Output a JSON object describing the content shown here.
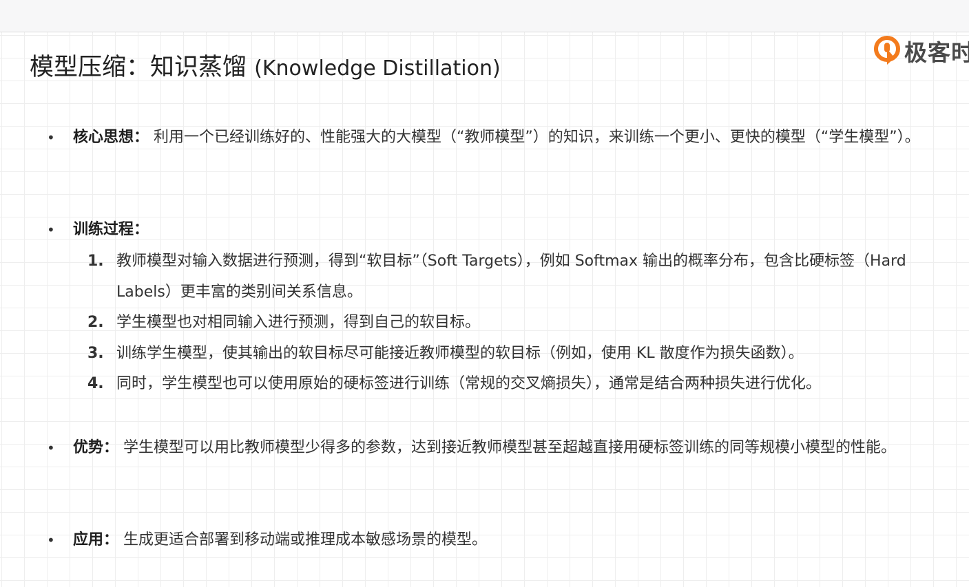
{
  "brand": {
    "name": "极客时间",
    "accent": "#f37b1d"
  },
  "slide": {
    "title_cn": "模型压缩：知识蒸馏",
    "title_en": "(Knowledge Distillation)"
  },
  "bullets": {
    "core_idea": {
      "label": "核心思想：",
      "text": "利用一个已经训练好的、性能强大的大模型（“教师模型”）的知识，来训练一个更小、更快的模型（“学生模型”）。"
    },
    "training": {
      "label": "训练过程：",
      "steps": [
        {
          "num": "1.",
          "text": "教师模型对输入数据进行预测，得到“软目标”（Soft Targets），例如 Softmax 输出的概率分布，包含比硬标签（Hard Labels）更丰富的类别间关系信息。"
        },
        {
          "num": "2.",
          "text": "学生模型也对相同输入进行预测，得到自己的软目标。"
        },
        {
          "num": "3.",
          "text": "训练学生模型，使其输出的软目标尽可能接近教师模型的软目标（例如，使用 KL 散度作为损失函数）。"
        },
        {
          "num": "4.",
          "text": "同时，学生模型也可以使用原始的硬标签进行训练（常规的交叉熵损失），通常是结合两种损失进行优化。"
        }
      ]
    },
    "advantage": {
      "label": "优势：",
      "text": "学生模型可以用比教师模型少得多的参数，达到接近教师模型甚至超越直接用硬标签训练的同等规模小模型的性能。"
    },
    "application": {
      "label": "应用：",
      "text": "生成更适合部署到移动端或推理成本敏感场景的模型。"
    }
  }
}
